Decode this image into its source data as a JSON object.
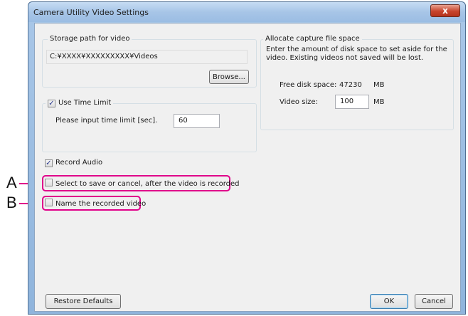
{
  "window": {
    "title": "Camera Utility Video Settings",
    "close_glyph": "x"
  },
  "storage": {
    "legend": "Storage path for video",
    "path": "C:¥XXXX¥XXXXXXXXX¥Videos",
    "browse_label": "Browse..."
  },
  "time_limit": {
    "checkbox_label": "Use Time Limit",
    "checked": true,
    "prompt": "Please input time limit [sec].",
    "value": "60"
  },
  "allocate": {
    "legend": "Allocate capture file space",
    "description_line1": "Enter the amount of disk space to set aside for the",
    "description_line2": "video.  Existing videos not saved will be lost.",
    "free_label": "Free disk space:",
    "free_value": "47230",
    "free_unit": "MB",
    "size_label": "Video size:",
    "size_value": "100",
    "size_unit": "MB"
  },
  "options": {
    "record_audio_label": "Record Audio",
    "record_audio_checked": true,
    "save_cancel_label": "Select to save or cancel, after the video is recorded",
    "save_cancel_checked": false,
    "name_video_label": "Name the recorded video",
    "name_video_checked": false
  },
  "footer": {
    "restore_label": "Restore Defaults",
    "ok_label": "OK",
    "cancel_label": "Cancel"
  },
  "callouts": {
    "a": "A",
    "b": "B"
  },
  "colors": {
    "highlight": "#e0008a",
    "title_bar": "#a7c5e7",
    "dialog_bg": "#f0f0f0"
  },
  "icons": {
    "check": "check-icon",
    "close": "close-icon"
  }
}
